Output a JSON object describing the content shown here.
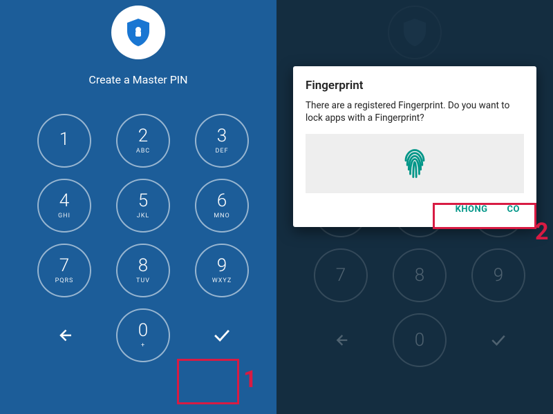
{
  "left": {
    "title": "Create a Master PIN",
    "keys": [
      {
        "num": "1",
        "sub": ""
      },
      {
        "num": "2",
        "sub": "ABC"
      },
      {
        "num": "3",
        "sub": "DEF"
      },
      {
        "num": "4",
        "sub": "GHI"
      },
      {
        "num": "5",
        "sub": "JKL"
      },
      {
        "num": "6",
        "sub": "MNO"
      },
      {
        "num": "7",
        "sub": "PQRS"
      },
      {
        "num": "8",
        "sub": "TUV"
      },
      {
        "num": "9",
        "sub": "WXYZ"
      }
    ],
    "zero": {
      "num": "0",
      "sub": "+"
    },
    "step_label": "1"
  },
  "right": {
    "dialog": {
      "title": "Fingerprint",
      "body": "There are a registered Fingerprint. Do you want to lock apps with a Fingerprint?",
      "no": "KHÔNG",
      "yes": "CÓ"
    },
    "step_label": "2"
  }
}
